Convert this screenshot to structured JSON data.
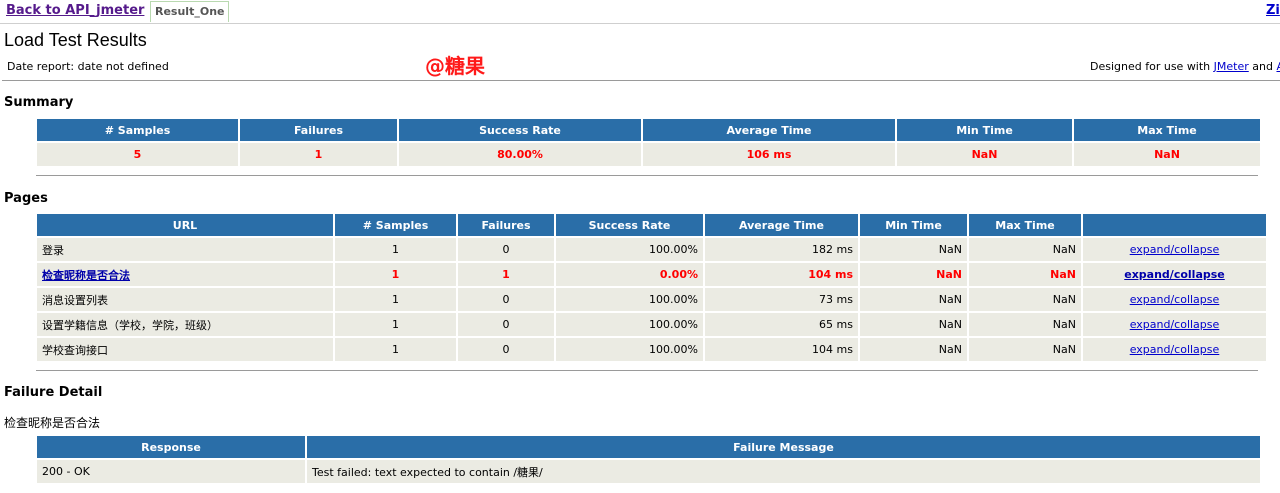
{
  "nav": {
    "back_link": "Back to API_jmeter",
    "tab": "Result_One",
    "right_cut": "Zi"
  },
  "header": {
    "title": "Load Test Results",
    "date_report": "Date report: date not defined",
    "watermark": "@糖果",
    "designed_prefix": "Designed for use with ",
    "jmeter_link": "JMeter",
    "designed_and": " and ",
    "ant_link": "An"
  },
  "summary": {
    "heading": "Summary",
    "columns": [
      "# Samples",
      "Failures",
      "Success Rate",
      "Average Time",
      "Min Time",
      "Max Time"
    ],
    "row": [
      "5",
      "1",
      "80.00%",
      "106 ms",
      "NaN",
      "NaN"
    ]
  },
  "pages": {
    "heading": "Pages",
    "columns": [
      "URL",
      "# Samples",
      "Failures",
      "Success Rate",
      "Average Time",
      "Min Time",
      "Max Time",
      ""
    ],
    "rows": [
      {
        "url": "登录",
        "samples": "1",
        "failures": "0",
        "rate": "100.00%",
        "avg": "182 ms",
        "min": "NaN",
        "max": "NaN",
        "action": "expand/collapse"
      },
      {
        "url": "检查昵称是否合法",
        "samples": "1",
        "failures": "1",
        "rate": "0.00%",
        "avg": "104 ms",
        "min": "NaN",
        "max": "NaN",
        "action": "expand/collapse"
      },
      {
        "url": "消息设置列表",
        "samples": "1",
        "failures": "0",
        "rate": "100.00%",
        "avg": "73 ms",
        "min": "NaN",
        "max": "NaN",
        "action": "expand/collapse"
      },
      {
        "url": "设置学籍信息（学校，学院，班级）",
        "samples": "1",
        "failures": "0",
        "rate": "100.00%",
        "avg": "65 ms",
        "min": "NaN",
        "max": "NaN",
        "action": "expand/collapse"
      },
      {
        "url": "学校查询接口",
        "samples": "1",
        "failures": "0",
        "rate": "100.00%",
        "avg": "104 ms",
        "min": "NaN",
        "max": "NaN",
        "action": "expand/collapse"
      }
    ]
  },
  "failure_detail": {
    "heading": "Failure Detail",
    "page_name": "检查昵称是否合法",
    "columns": [
      "Response",
      "Failure Message"
    ],
    "row": [
      "200 - OK",
      "Test failed: text expected to contain /糖果/"
    ]
  },
  "colors": {
    "header_bg": "#2a6ea8",
    "cell_bg": "#ebebe3",
    "failure_text": "#ff0000"
  }
}
